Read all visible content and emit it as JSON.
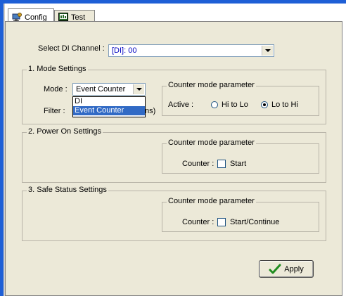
{
  "tabs": [
    {
      "label": "Config",
      "icon": "config-icon",
      "active": true
    },
    {
      "label": "Test",
      "icon": "test-icon",
      "active": false
    }
  ],
  "channel": {
    "label": "Select DI Channel :",
    "value": "[DI]: 00"
  },
  "mode_settings": {
    "title": "1. Mode Settings",
    "mode_label": "Mode :",
    "mode_value": "Event Counter",
    "filter_label": "Filter :",
    "filter_suffix": "ns)",
    "dropdown_options": [
      "DI",
      "Event Counter"
    ],
    "dropdown_selected": "Event Counter",
    "param_title": "Counter mode parameter",
    "active_label": "Active :",
    "radio_hi_lo": "Hi to Lo",
    "radio_lo_hi": "Lo to Hi",
    "selected_radio": "Lo to Hi"
  },
  "power_on": {
    "title": "2. Power On Settings",
    "param_title": "Counter mode parameter",
    "counter_label": "Counter :",
    "checkbox_label": "Start",
    "checked": false
  },
  "safe_status": {
    "title": "3. Safe Status Settings",
    "param_title": "Counter mode parameter",
    "counter_label": "Counter :",
    "checkbox_label": "Start/Continue",
    "checked": false
  },
  "apply_label": "Apply",
  "colors": {
    "frame_blue": "#1e5fd6",
    "selection_blue": "#316ac5",
    "apply_check_green": "#1f8c1f"
  }
}
